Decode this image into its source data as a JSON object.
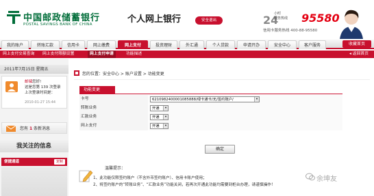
{
  "header": {
    "logo_cn": "中国邮政储蓄银行",
    "logo_en": "POSTAL SAVINGS BANK OF CHINA",
    "title": "个人网上银行",
    "exit_label": "安全退出",
    "hotline_24": "24",
    "hotline_unit_1": "小时",
    "hotline_unit_2": "服务热线",
    "hotline_number": "95580",
    "card_hotline": "信用卡服务热线 400-88-95580"
  },
  "nav": {
    "items": [
      {
        "label": "我的账户",
        "active": false
      },
      {
        "label": "转账汇款",
        "active": false
      },
      {
        "label": "信用卡",
        "active": false
      },
      {
        "label": "网上缴费",
        "active": false
      },
      {
        "label": "网上支付",
        "active": true
      },
      {
        "label": "投资理财",
        "active": false
      },
      {
        "label": "外汇通",
        "active": false
      },
      {
        "label": "个人贷款",
        "active": false
      },
      {
        "label": "申请开办",
        "active": false
      },
      {
        "label": "安全中心",
        "active": false
      },
      {
        "label": "客户服务",
        "active": false
      }
    ],
    "close_label": "收藏首页"
  },
  "subnav": {
    "items": [
      {
        "label": "网上支付交易查询",
        "active": false
      },
      {
        "label": "网上支付限额设置",
        "active": false
      },
      {
        "label": "网上支付申请",
        "active": true
      },
      {
        "label": "功能描述",
        "active": false
      }
    ],
    "back_label": "返回首页"
  },
  "sidebar": {
    "date": "2011年7月15日 星期五",
    "user_name": "邮储",
    "greeting_suffix": "您好!",
    "login_line_prefix": "这是您第",
    "login_count": "139",
    "login_line_suffix": "次登录",
    "last_login_label": "上次登录时间是：",
    "last_login_time": "2010-01-27 15:44",
    "msg_prefix": "您有",
    "msg_count": "1",
    "msg_suffix": "条新消息",
    "follow_title": "我关注的信息",
    "quick_label": "便捷通道",
    "quick_btn": "定制"
  },
  "main": {
    "crumb_prefix": "您的位置：",
    "crumb_path": "安全中心 > 账户设置 > 功能变更",
    "tab_label": "功能变更",
    "rows": [
      {
        "label": "卡号",
        "value": "6210982400001085888/绿卡通卡/无/签约账户/"
      },
      {
        "label": "转账业务",
        "value": "开通"
      },
      {
        "label": "汇款业务",
        "value": "开通"
      },
      {
        "label": "网上支付",
        "value": "开通"
      }
    ],
    "confirm_label": "确定",
    "tips_title": "温馨提示：",
    "tips": [
      "1、此功能仅限签约账户（不含外币签约账户）、信用卡账户使用；",
      "2、将签约账户的“转账业务”、“汇款业务”功能关闭，若再次开通此功能均需要到柜台办理，请谨慎操作！"
    ]
  },
  "watermark": "余坤友",
  "colors": {
    "brand_red": "#c8102e",
    "brand_green": "#006d39"
  }
}
